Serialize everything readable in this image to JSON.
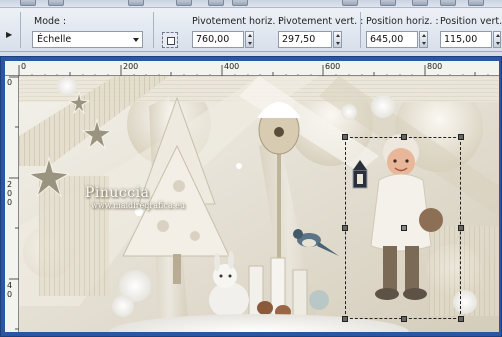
{
  "toolbar": {
    "icons": [
      "new-file-icon",
      "save-icon",
      "print-icon",
      "undo-icon",
      "redo-icon",
      "copy-icon",
      "info-icon",
      "layers-icon",
      "tools-icon",
      "zoom-in-icon",
      "zoom-out-icon"
    ]
  },
  "propbar": {
    "mode_label": "Mode :",
    "mode_value": "Échelle",
    "pivot_h_label": "Pivotement horiz. :",
    "pivot_h_value": "760,00",
    "pivot_v_label": "Pivotement vert. :",
    "pivot_v_value": "297,50",
    "pos_h_label": "Position horiz. :",
    "pos_h_value": "645,00",
    "pos_v_label": "Position vert. :",
    "pos_v_value": "115,00"
  },
  "ruler": {
    "top_labels": [
      "0",
      "200",
      "400",
      "600",
      "800"
    ],
    "left_labels": [
      "0",
      "2",
      "0",
      "0",
      "4",
      "0"
    ]
  },
  "watermark": {
    "name": "Pinuccia",
    "url": "www.maidireqrafica.eu"
  },
  "colors": {
    "window_frame": "#2c56a3",
    "canvas_base": "#e9e5dc",
    "accent_gold": "#b9aa8a"
  }
}
